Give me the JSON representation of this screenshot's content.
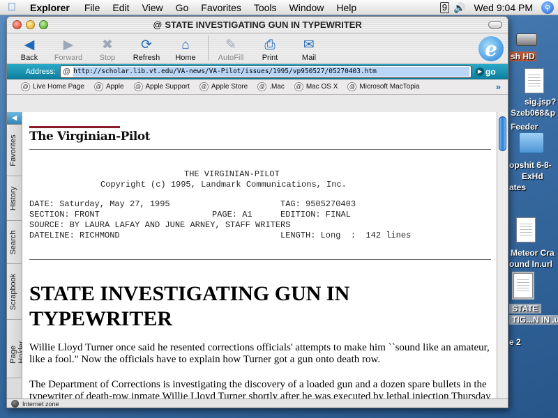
{
  "menubar": {
    "app_name": "Explorer",
    "items": [
      "File",
      "Edit",
      "View",
      "Go",
      "Favorites",
      "Tools",
      "Window",
      "Help"
    ],
    "clock": "Wed 9:04 PM"
  },
  "window": {
    "title": "STATE INVESTIGATING GUN IN TYPEWRITER"
  },
  "toolbar": {
    "back": "Back",
    "forward": "Forward",
    "stop": "Stop",
    "refresh": "Refresh",
    "home": "Home",
    "autofill": "AutoFill",
    "print": "Print",
    "mail": "Mail"
  },
  "address": {
    "label": "Address:",
    "url": "http://scholar.lib.vt.edu/VA-news/VA-Pilot/issues/1995/vp950527/05270403.htm",
    "go": "go"
  },
  "favorites_bar": [
    "Live Home Page",
    "Apple",
    "Apple Support",
    "Apple Store",
    ".Mac",
    "Mac OS X",
    "Microsoft MacTopia"
  ],
  "side_tabs": [
    "Favorites",
    "History",
    "Search",
    "Scrapbook",
    "Page Holder"
  ],
  "article": {
    "masthead": "The Virginian-Pilot",
    "header_line1": "THE VIRGINIAN-PILOT",
    "header_line2": "Copyright (c) 1995, Landmark Communications, Inc.",
    "meta": {
      "date": "DATE: Saturday, May 27, 1995",
      "tag": "TAG: 9505270403",
      "section": "SECTION: FRONT",
      "page": "PAGE: A1",
      "edition": "EDITION: FINAL",
      "source": "SOURCE: BY LAURA LAFAY AND JUNE ARNEY, STAFF WRITERS",
      "dateline": "DATELINE: RICHMOND",
      "length": "LENGTH: Long  :  142 lines"
    },
    "headline": "STATE INVESTIGATING GUN IN TYPEWRITER",
    "paragraphs": [
      "Willie Lloyd Turner once said he resented corrections officials' attempts to make him ``sound like an amateur, like a fool.\" Now the officials have to explain how Turner got a gun onto death row.",
      "The Department of Corrections is investigating the discovery of a loaded gun and a dozen spare bullets in the typewriter of death-row inmate Willie Lloyd Turner shortly after he was executed by lethal injection Thursday night."
    ]
  },
  "status": {
    "zone": "Internet zone"
  },
  "desktop": {
    "hd_label": "sh HD",
    "file1_line1": "sig.jsp?",
    "file1_line2": "Szeb068&p",
    "file1_line3": "Feeder",
    "folder_line1": "opshit 6-8-",
    "folder_line2": "ExHd",
    "folder_line3": "ates",
    "url_line1": "Meteor Cra",
    "url_line2": "ound In.url",
    "sel_line1": "STATE",
    "sel_line2": "TIG...N IN .u",
    "partial": "e 2"
  }
}
